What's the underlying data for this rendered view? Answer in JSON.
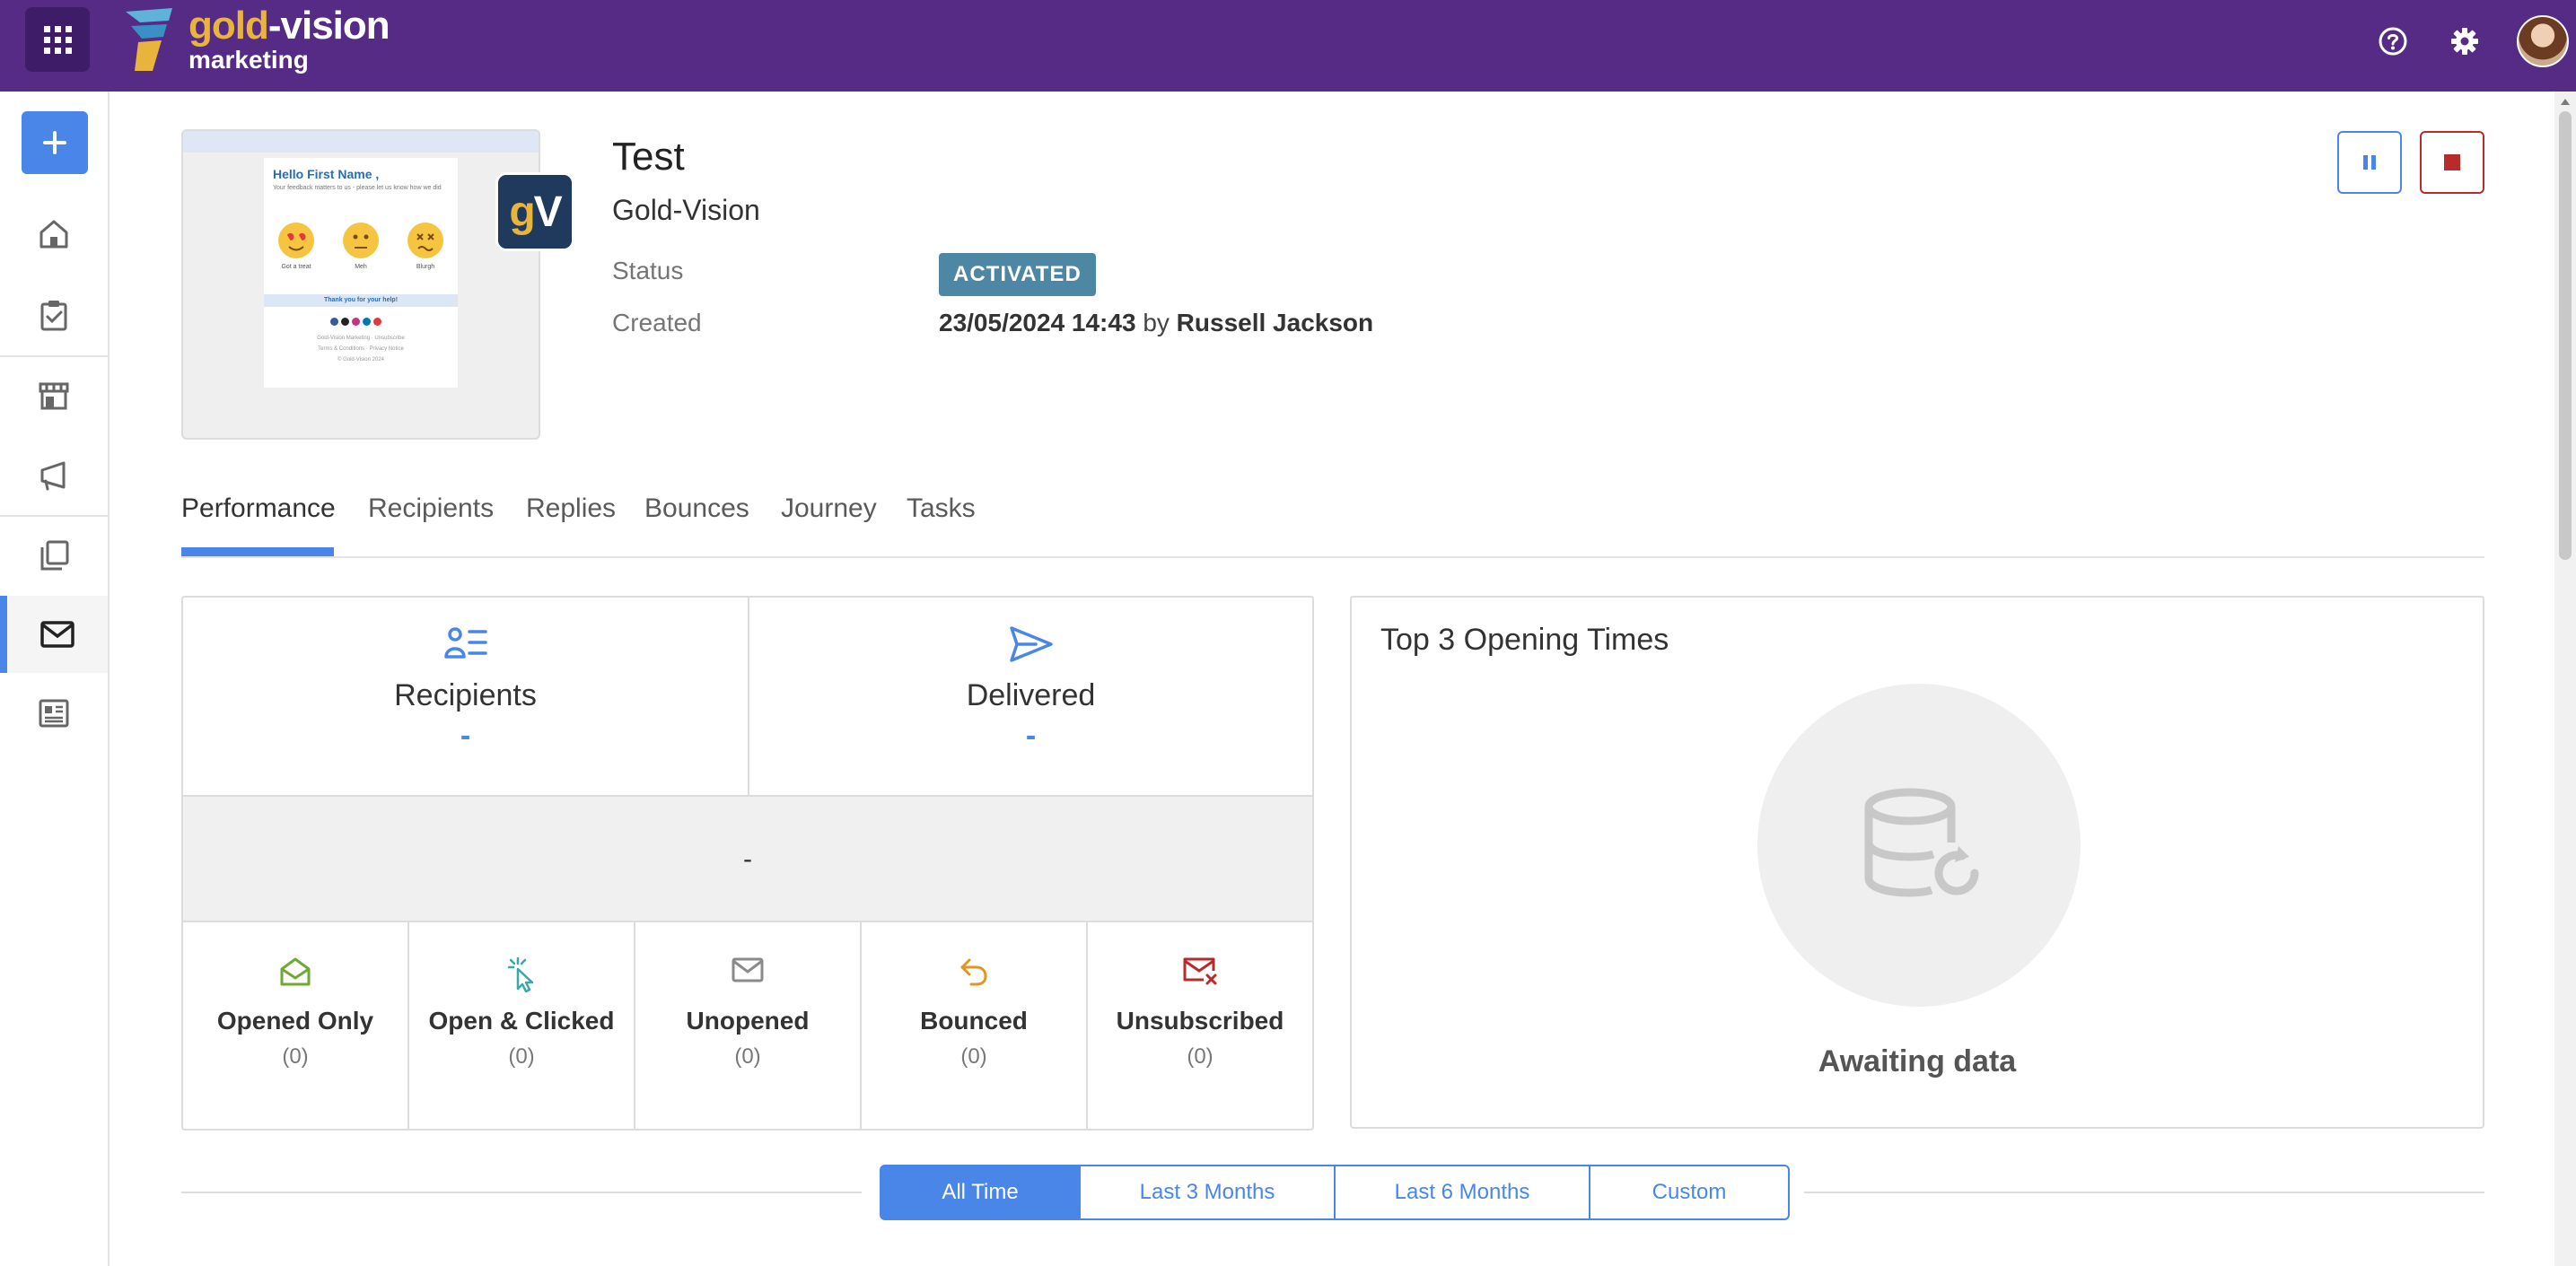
{
  "app": {
    "logo_line1_a": "gold",
    "logo_line1_b": "-vision",
    "logo_line2": "marketing",
    "accent": "#4a86e8",
    "brand": "#552b86"
  },
  "topbar": {
    "icons": [
      "apps-grid-icon",
      "help-icon",
      "settings-icon",
      "user-avatar"
    ]
  },
  "sidebar": {
    "items": [
      {
        "name": "add",
        "icon": "plus-icon"
      },
      {
        "name": "home",
        "icon": "home-icon"
      },
      {
        "name": "tasks",
        "icon": "clipboard-check-icon"
      },
      {
        "name": "store",
        "icon": "storefront-icon"
      },
      {
        "name": "campaigns",
        "icon": "megaphone-icon"
      },
      {
        "name": "documents",
        "icon": "copy-icon"
      },
      {
        "name": "email",
        "icon": "envelope-icon",
        "active": true
      },
      {
        "name": "newsletters",
        "icon": "newspaper-icon"
      }
    ]
  },
  "thumbnail": {
    "heading": "Hello First Name ,",
    "subtext": "Your feedback matters to us - please let us know how we did",
    "emojis": [
      "Got a treat",
      "Meh",
      "Blurgh"
    ],
    "band": "Thank you for your help!",
    "footer_line1": "Gold-Vision Marketing · Unsubscribe",
    "footer_line2": "Terms & Conditions · Privacy Notice",
    "footer_line3": "© Gold-Vision 2024"
  },
  "badge": {
    "letter_g": "g",
    "letter_v": "V"
  },
  "header": {
    "title": "Test",
    "subtitle": "Gold-Vision",
    "status_label": "Status",
    "status_value": "ACTIVATED",
    "status_color": "#4e87a3",
    "created_label": "Created",
    "created_date": "23/05/2024 14:43",
    "created_by_word": "by",
    "created_by": "Russell Jackson"
  },
  "controls": {
    "pause": "pause-icon",
    "stop": "stop-icon"
  },
  "tabs": [
    "Performance",
    "Recipients",
    "Replies",
    "Bounces",
    "Journey",
    "Tasks"
  ],
  "performance": {
    "recipients_label": "Recipients",
    "recipients_value": "-",
    "delivered_label": "Delivered",
    "delivered_value": "-",
    "mid_value": "-",
    "cells": [
      {
        "label": "Opened Only",
        "count": "(0)",
        "icon": "open-envelope-icon",
        "color": "#6fa832"
      },
      {
        "label": "Open & Clicked",
        "count": "(0)",
        "icon": "cursor-click-icon",
        "color": "#3aa8a8"
      },
      {
        "label": "Unopened",
        "count": "(0)",
        "icon": "envelope-icon",
        "color": "#8a8a8a"
      },
      {
        "label": "Bounced",
        "count": "(0)",
        "icon": "undo-arrow-icon",
        "color": "#e0961f"
      },
      {
        "label": "Unsubscribed",
        "count": "(0)",
        "icon": "envelope-x-icon",
        "color": "#b72b2b"
      }
    ]
  },
  "top3": {
    "title": "Top 3 Opening Times",
    "empty_message": "Awaiting data"
  },
  "range": {
    "options": [
      "All Time",
      "Last 3 Months",
      "Last 6 Months",
      "Custom"
    ],
    "selected": "All Time"
  }
}
